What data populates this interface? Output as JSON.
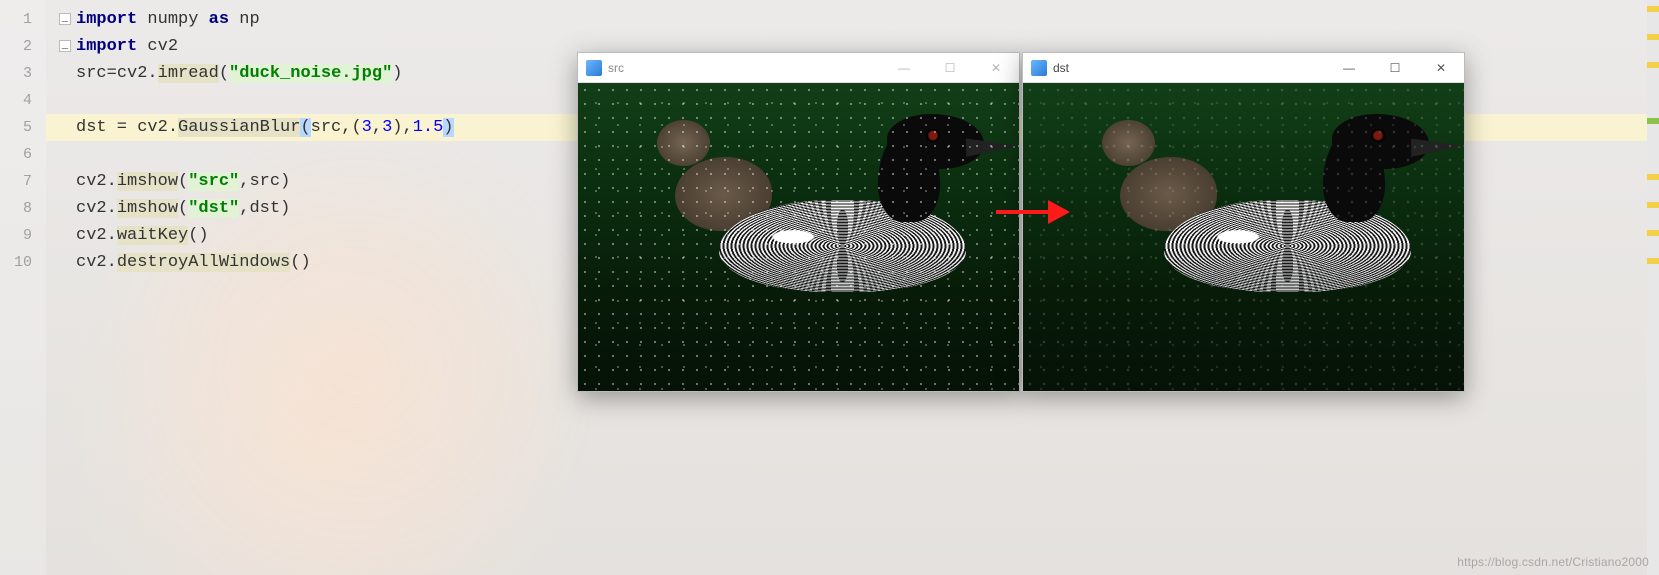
{
  "code": {
    "lines": [
      {
        "n": "1",
        "t": "import numpy as np"
      },
      {
        "n": "2",
        "t": "import cv2"
      },
      {
        "n": "3",
        "t": "src=cv2.imread(\"duck_noise.jpg\")"
      },
      {
        "n": "4",
        "t": ""
      },
      {
        "n": "5",
        "t": "dst = cv2.GaussianBlur(src,(3,3),1.5)"
      },
      {
        "n": "6",
        "t": ""
      },
      {
        "n": "7",
        "t": "cv2.imshow(\"src\",src)"
      },
      {
        "n": "8",
        "t": "cv2.imshow(\"dst\",dst)"
      },
      {
        "n": "9",
        "t": "cv2.waitKey()"
      },
      {
        "n": "10",
        "t": "cv2.destroyAllWindows()"
      }
    ],
    "highlighted_line": "5",
    "tokens": {
      "kw_import": "import",
      "kw_as": "as",
      "id_numpy": "numpy",
      "id_np": "np",
      "id_cv2": "cv2",
      "id_src": "src",
      "id_dst": "dst",
      "fn_imread": "imread",
      "fn_gauss": "GaussianBlur",
      "fn_imshow": "imshow",
      "fn_waitkey": "waitKey",
      "fn_destroy": "destroyAllWindows",
      "str_duck": "\"duck_noise.jpg\"",
      "str_src": "\"src\"",
      "str_dst": "\"dst\"",
      "num_3a": "3",
      "num_3b": "3",
      "num_15": "1.5"
    }
  },
  "windows": {
    "src": {
      "title": "src",
      "min": "—",
      "max": "☐",
      "close": "✕",
      "active": false
    },
    "dst": {
      "title": "dst",
      "min": "—",
      "max": "☐",
      "close": "✕",
      "active": true
    }
  },
  "watermark": "https://blog.csdn.net/Cristiano2000"
}
